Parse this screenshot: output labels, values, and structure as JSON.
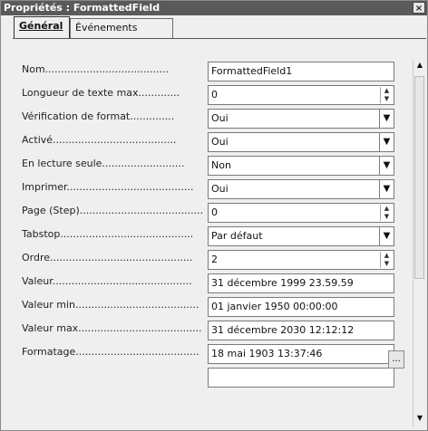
{
  "window": {
    "title": "Propriétés : FormattedField",
    "close_label": "×"
  },
  "tabs": [
    {
      "label": "Général"
    },
    {
      "label": "Événements"
    }
  ],
  "fields": [
    {
      "label": "Nom.......................................",
      "value": "FormattedField1",
      "control": "text"
    },
    {
      "label": "Longueur de texte max.............",
      "value": "0",
      "control": "spin"
    },
    {
      "label": "Vérification de format..............",
      "value": "Oui",
      "control": "select"
    },
    {
      "label": "Activé.......................................",
      "value": "Oui",
      "control": "select"
    },
    {
      "label": "En lecture seule..........................",
      "value": "Non",
      "control": "select"
    },
    {
      "label": "Imprimer........................................",
      "value": "Oui",
      "control": "select"
    },
    {
      "label": "Page (Step).......................................",
      "value": "0",
      "control": "spin"
    },
    {
      "label": "Tabstop..........................................",
      "value": "Par défaut",
      "control": "select"
    },
    {
      "label": "Ordre.............................................",
      "value": "2",
      "control": "spin"
    },
    {
      "label": "Valeur............................................",
      "value": "31 décembre 1999 23.59.59",
      "control": "text"
    },
    {
      "label": "Valeur min.......................................",
      "value": "01 janvier 1950 00:00:00",
      "control": "text"
    },
    {
      "label": "Valeur max.......................................",
      "value": "31 décembre 2030 12:12:12",
      "control": "text"
    },
    {
      "label": "Formatage.......................................",
      "value": "18 mai 1903 13:37:46",
      "control": "text"
    },
    {
      "label": "",
      "value": "",
      "control": "text"
    }
  ],
  "format_button_label": "..."
}
